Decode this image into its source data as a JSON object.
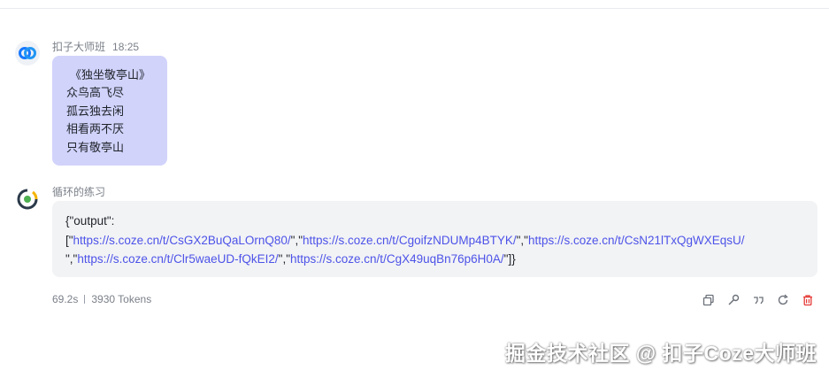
{
  "user_message": {
    "sender": "扣子大师班",
    "time": "18:25",
    "lines": [
      "《独坐敬亭山》",
      "众鸟高飞尽",
      "孤云独去闲",
      "相看两不厌",
      "只有敬亭山"
    ]
  },
  "bot_message": {
    "sender": "循环的练习",
    "output_key": "{\"output\":",
    "open_bracket": "[\"",
    "sep_1": "\",\"",
    "sep_2": "\",\"",
    "sep_3": "\",\"",
    "sep_4": "\",\"",
    "close": "\"]}",
    "line2_prefix": "\",\"",
    "urls": [
      "https://s.coze.cn/t/CsGX2BuQaLOrnQ80/",
      "https://s.coze.cn/t/CgoifzNDUMp4BTYK/",
      "https://s.coze.cn/t/CsN21lTxQgWXEqsU/",
      "https://s.coze.cn/t/Clr5waeUD-fQkEI2/",
      "https://s.coze.cn/t/CgX49uqBn76p6H0A/"
    ],
    "link_color": "#4d53e8"
  },
  "stats": {
    "duration": "69.2s",
    "tokens": "3930 Tokens"
  },
  "actions": [
    {
      "name": "copy-icon"
    },
    {
      "name": "debug-icon"
    },
    {
      "name": "quote-icon"
    },
    {
      "name": "regenerate-icon"
    },
    {
      "name": "delete-icon",
      "color": "#e53935"
    }
  ],
  "watermark": "掘金技术社区 @ 扣子Coze大师班"
}
